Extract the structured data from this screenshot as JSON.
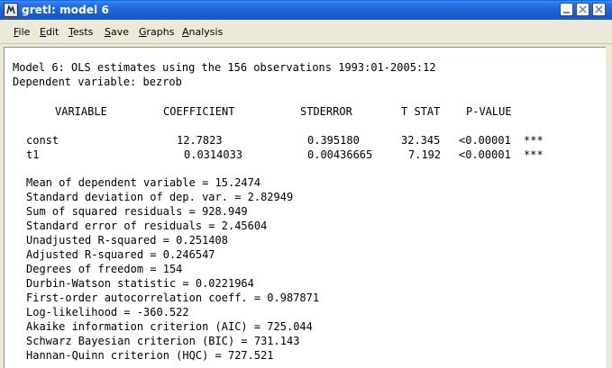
{
  "window": {
    "title": "gretl: model 6"
  },
  "menu": [
    {
      "accel": "F",
      "rest": "ile"
    },
    {
      "accel": "E",
      "rest": "dit"
    },
    {
      "accel": "T",
      "rest": "ests"
    },
    {
      "accel": "S",
      "rest": "ave"
    },
    {
      "accel": "G",
      "rest": "raphs"
    },
    {
      "accel": "A",
      "rest": "nalysis"
    }
  ],
  "output": {
    "header_line1": "Model 6: OLS estimates using the 156 observations 1993:01-2005:12",
    "header_line2": "Dependent variable: bezrob",
    "columns": [
      "VARIABLE",
      "COEFFICIENT",
      "STDERROR",
      "T STAT",
      "P-VALUE"
    ],
    "rows": [
      {
        "variable": "const",
        "coefficient": "12.7823",
        "stderror": "0.395180",
        "tstat": "32.345",
        "pvalue": "<0.00001",
        "stars": "***"
      },
      {
        "variable": "t1",
        "coefficient": "0.0314033",
        "stderror": "0.00436665",
        "tstat": "7.192",
        "pvalue": "<0.00001",
        "stars": "***"
      }
    ],
    "stats": [
      "Mean of dependent variable = 15.2474",
      "Standard deviation of dep. var. = 2.82949",
      "Sum of squared residuals = 928.949",
      "Standard error of residuals = 2.45604",
      "Unadjusted R-squared = 0.251408",
      "Adjusted R-squared = 0.246547",
      "Degrees of freedom = 154",
      "Durbin-Watson statistic = 0.0221964",
      "First-order autocorrelation coeff. = 0.987871",
      "Log-likelihood = -360.522",
      "Akaike information criterion (AIC) = 725.044",
      "Schwarz Bayesian criterion (BIC) = 731.143",
      "Hannan-Quinn criterion (HQC) = 727.521"
    ]
  }
}
